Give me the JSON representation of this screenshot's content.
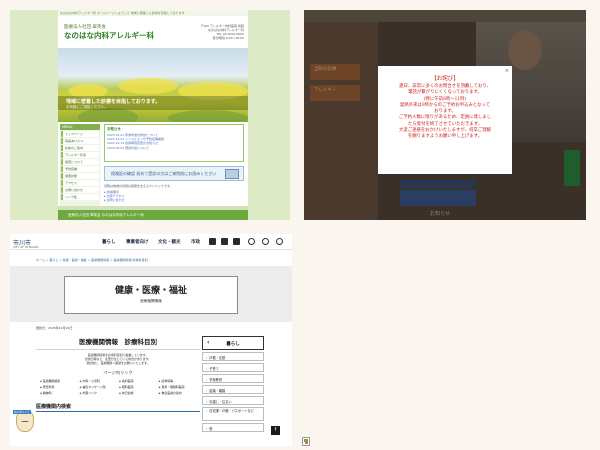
{
  "panel1": {
    "top_strip": "なのはな内科アレルギー科 ホームページへようこそ 地域に根差した診療を目指しております",
    "corp_name": "医療法人社団 翠英会",
    "clinic_name": "なのはな内科アレルギー科",
    "header_right_lines": [
      "〒000 アレルギー内科医院 地図",
      "なのはな内科アレルギー科",
      "TEL 00-0000-0000",
      "受付時間 9:00〜18:00"
    ],
    "hero_line1": "地域に密着した診療を目指しております。",
    "hero_line2": "お気軽にご相談ください。",
    "sidebar_head": "MENU",
    "sidebar_items": [
      "トップページ",
      "院長あいさつ",
      "診療のご案内",
      "アレルギー外来",
      "検査について",
      "予防接種",
      "健康診断",
      "アクセス",
      "お問い合わせ",
      "リンク集"
    ],
    "news_head": "お知らせ",
    "news_items": [
      "2023.01.01 年末年始の休診について",
      "2022.12.01 インフルエンザ予防接種開始",
      "2022.10.15 診療時間変更のお知らせ",
      "2022.09.01 発熱外来について"
    ],
    "banner_text": "保険証の確認 初めて受診の方はご来院前にお読みください",
    "small_text": "当院は地域の皆様の健康を支えるクリニックです。",
    "links": [
      "▸ 診療時間",
      "▸ 交通アクセス",
      "▸ お問い合わせ"
    ],
    "footer_text": "医療法人社団 翠英会 なのはな内科アレルギー科"
  },
  "panel2": {
    "bg_label1": "当院の診療",
    "bg_label2": "アレルギー",
    "bg_footer": "お知らせ",
    "close_label": "×",
    "title": "【お詫び】",
    "lines": [
      "連日、非常に多くのお問合せを頂戴しており、",
      "電話が繋がりにくくなっております。",
      "(特に午前8時〜11時)",
      "発熱外来は9時からのご予約お申込みとなって",
      "おります。",
      "ご予約人数に限りがあるため、定員に達しまし",
      "たら受付を終了させていただきます。",
      "大変ご迷惑をおかけいたしますが、何卒ご理解",
      "を賜りますようお願い申し上げます。"
    ]
  },
  "panel3": {
    "logo": "市川市",
    "logo_sub": "CITY OF ICHIKAWA",
    "nav": [
      "暮らし",
      "事業者向け",
      "文化・観光",
      "市政"
    ],
    "breadcrumb": "ホーム > 暮らし > 健康・医療・福祉 > 医療機関情報 > 医療機関情報 診療科目別",
    "hero_title": "健康・医療・福祉",
    "hero_sub": "医療機関情報",
    "updated": "更新日：2025年10月15日",
    "page_title": "医療機関情報　診療科目別",
    "intro": [
      "医療機関情報を診療科目別に掲載しています。",
      "診療日時など、変更が生じている場合があります。",
      "受診前に、医療機関へ確認をお願いいたします。"
    ],
    "links_head": "ページ内リンク",
    "links": [
      "医療機関検索",
      "内科・小児科",
      "歯科医院",
      "接骨院等",
      "整形外科",
      "鍼灸マッサージ院",
      "眼科医院",
      "耳鼻・咽喉科医院",
      "精神科",
      "外部リンク",
      "休日診療",
      "救急医療の案内"
    ],
    "search_head": "医療機関内検索",
    "rnav_head": "暮らし",
    "rnav_items": [
      "戸籍・住基",
      "子育て",
      "学校教育",
      "結婚・離婚",
      "引越し・住まい",
      "住宅課・戸籍・パスポートなど",
      "税"
    ],
    "to_top": "↑",
    "mascot_tag": "市川市キャラ"
  }
}
